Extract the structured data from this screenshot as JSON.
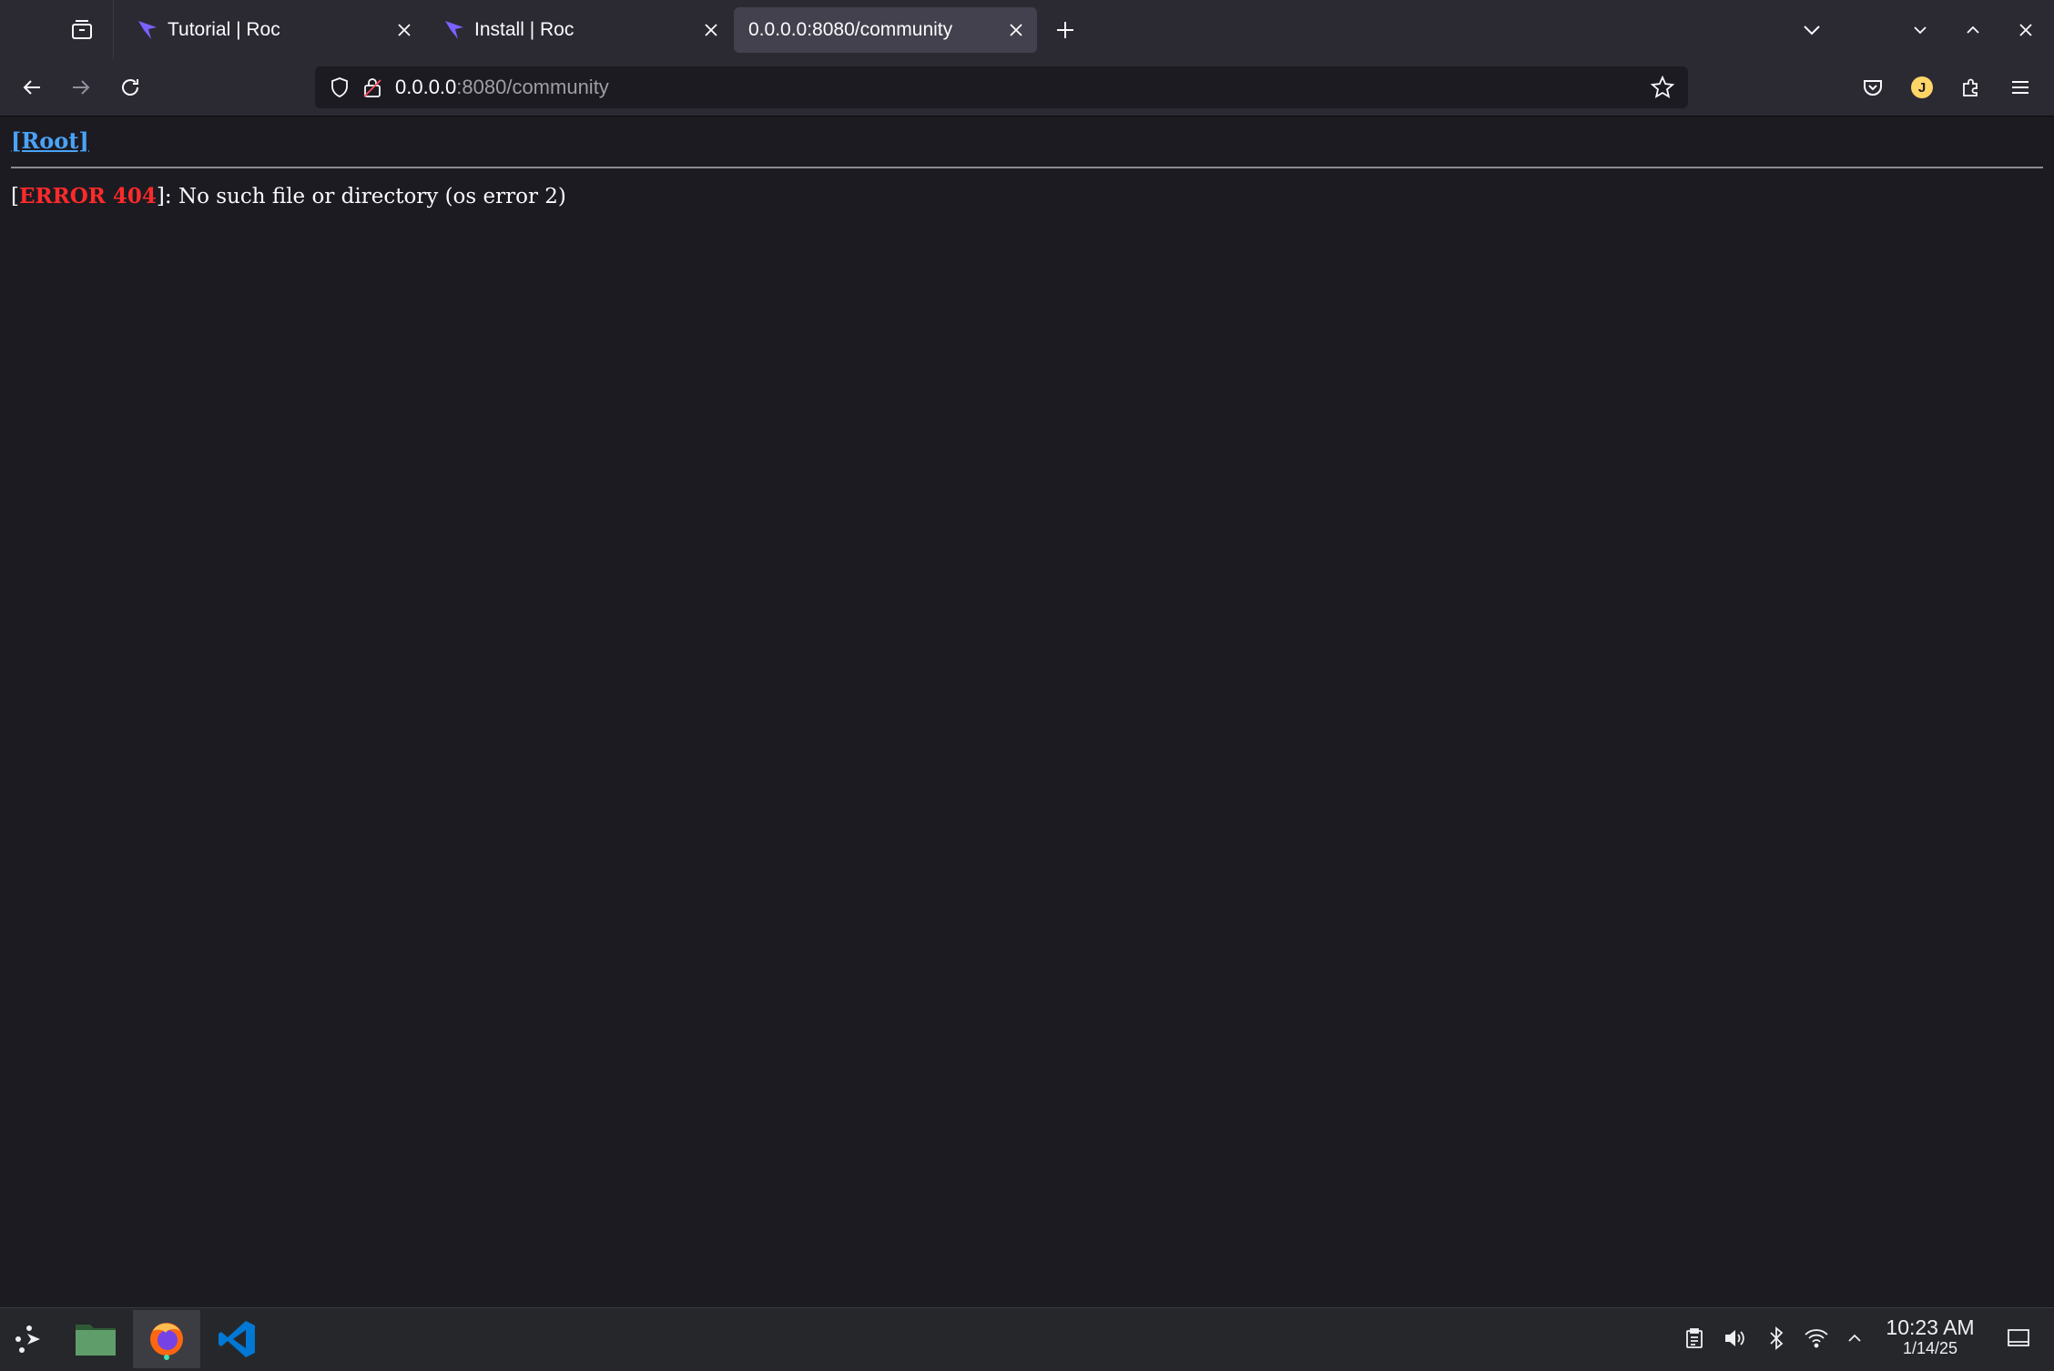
{
  "browser": {
    "tabs": [
      {
        "title": "Tutorial | Roc",
        "favicon": "roc-icon",
        "active": false
      },
      {
        "title": "Install | Roc",
        "favicon": "roc-icon",
        "active": false
      },
      {
        "title": "0.0.0.0:8080/community",
        "favicon": "",
        "active": true
      }
    ],
    "url_host": "0.0.0.0",
    "url_rest": ":8080/community",
    "profile_initial": "J"
  },
  "page": {
    "root_link": "[Root]",
    "error_open": "[",
    "error_label": "ERROR 404",
    "error_message": "]: No such file or directory (os error 2)"
  },
  "taskbar": {
    "time": "10:23 AM",
    "date": "1/14/25",
    "apps": [
      "launcher-icon",
      "file-manager-icon",
      "firefox-icon",
      "vscode-icon"
    ]
  },
  "colors": {
    "accent_link": "#4aa3f7",
    "error_red": "#ff2a2a",
    "roc_purple": "#7b61ff",
    "page_bg": "#1c1b22"
  }
}
